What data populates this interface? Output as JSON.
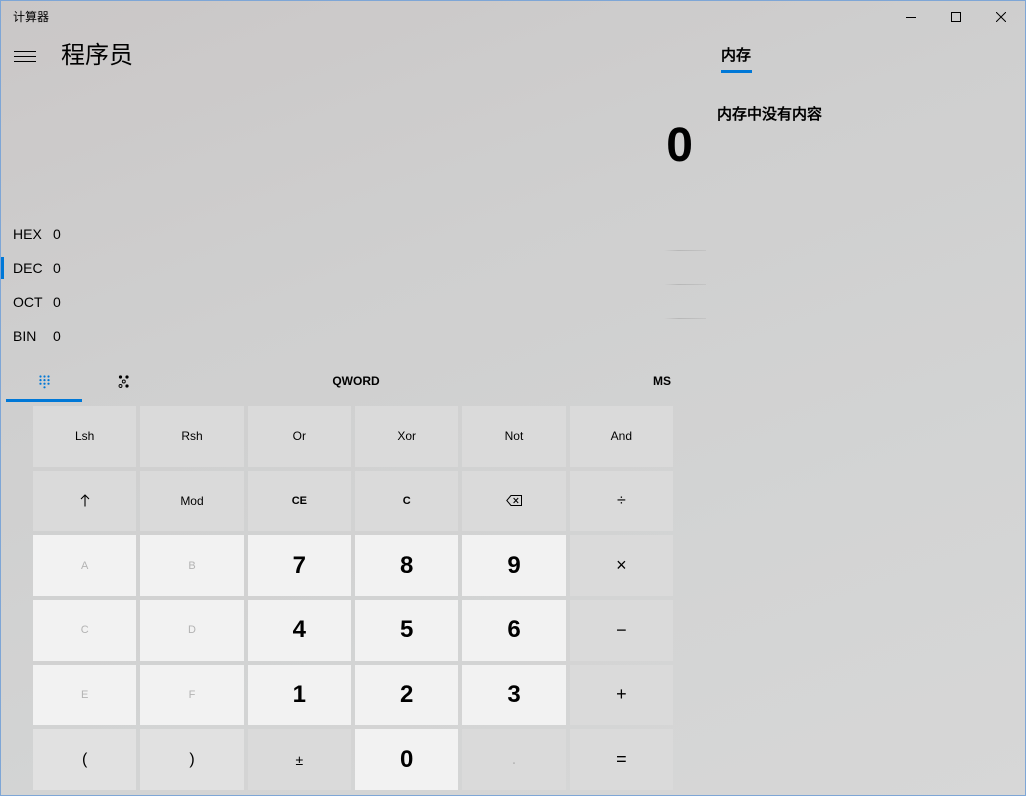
{
  "window": {
    "title": "计算器",
    "minimize_icon": "minimize-icon",
    "maximize_icon": "maximize-icon",
    "close_icon": "close-icon"
  },
  "header": {
    "menu_icon": "hamburger-menu-icon",
    "mode_title": "程序员"
  },
  "display": {
    "value": "0"
  },
  "radix": [
    {
      "label": "HEX",
      "value": "0",
      "selected": false
    },
    {
      "label": "DEC",
      "value": "0",
      "selected": true
    },
    {
      "label": "OCT",
      "value": "0",
      "selected": false
    },
    {
      "label": "BIN",
      "value": "0",
      "selected": false
    }
  ],
  "toolbar": {
    "full_keypad_icon": "full-keypad-icon",
    "full_keypad_selected": true,
    "bit_toggling_icon": "bit-toggling-keypad-icon",
    "bit_toggling_selected": false,
    "word_size": "QWORD",
    "memory_store": "MS"
  },
  "keypad": {
    "rows": [
      [
        {
          "label": "Lsh",
          "enabled": true
        },
        {
          "label": "Rsh",
          "enabled": true
        },
        {
          "label": "Or",
          "enabled": true
        },
        {
          "label": "Xor",
          "enabled": true
        },
        {
          "label": "Not",
          "enabled": true
        },
        {
          "label": "And",
          "enabled": true
        }
      ],
      [
        {
          "icon": "shift-up-arrow-icon",
          "enabled": true
        },
        {
          "label": "Mod",
          "enabled": true
        },
        {
          "label": "CE",
          "enabled": true
        },
        {
          "label": "C",
          "enabled": true
        },
        {
          "icon": "backspace-icon",
          "enabled": true
        },
        {
          "label": "÷",
          "enabled": true
        }
      ],
      [
        {
          "label": "A",
          "enabled": false
        },
        {
          "label": "B",
          "enabled": false
        },
        {
          "label": "7",
          "enabled": true
        },
        {
          "label": "8",
          "enabled": true
        },
        {
          "label": "9",
          "enabled": true
        },
        {
          "label": "×",
          "enabled": true
        }
      ],
      [
        {
          "label": "C",
          "enabled": false
        },
        {
          "label": "D",
          "enabled": false
        },
        {
          "label": "4",
          "enabled": true
        },
        {
          "label": "5",
          "enabled": true
        },
        {
          "label": "6",
          "enabled": true
        },
        {
          "label": "−",
          "enabled": true
        }
      ],
      [
        {
          "label": "E",
          "enabled": false
        },
        {
          "label": "F",
          "enabled": false
        },
        {
          "label": "1",
          "enabled": true
        },
        {
          "label": "2",
          "enabled": true
        },
        {
          "label": "3",
          "enabled": true
        },
        {
          "label": "+",
          "enabled": true
        }
      ],
      [
        {
          "label": "(",
          "enabled": true
        },
        {
          "label": ")",
          "enabled": true
        },
        {
          "label": "±",
          "enabled": true
        },
        {
          "label": "0",
          "enabled": true
        },
        {
          "label": ".",
          "enabled": false
        },
        {
          "label": "=",
          "enabled": true
        }
      ]
    ]
  },
  "memory_panel": {
    "tab_label": "内存",
    "tab_selected": true,
    "empty_message": "内存中没有内容"
  },
  "colors": {
    "accent": "#0078d7",
    "number_key": "#f2f2f2",
    "function_key": "#dadada",
    "disabled_text": "#b3b3b3"
  }
}
